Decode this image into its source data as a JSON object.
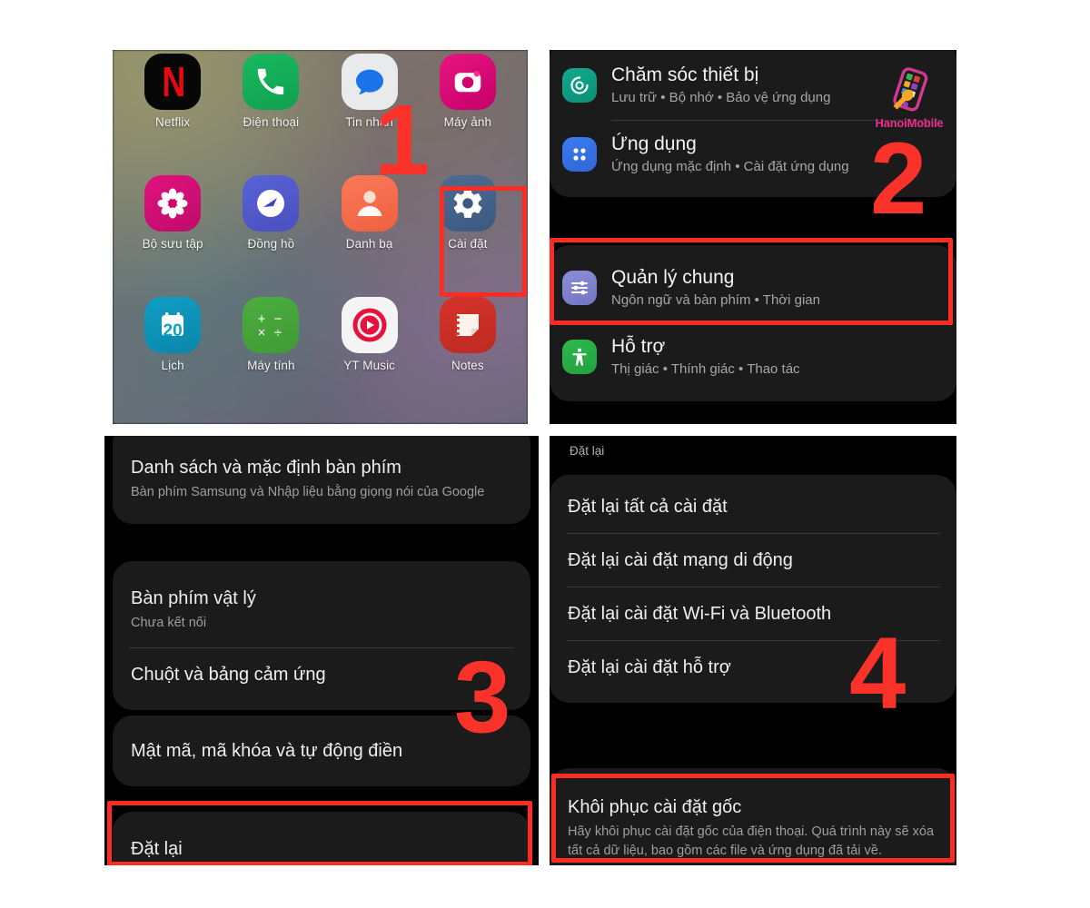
{
  "home": {
    "apps": [
      {
        "label": "Netflix",
        "icon": "netflix-icon"
      },
      {
        "label": "Điện thoại",
        "icon": "phone-icon"
      },
      {
        "label": "Tin nhắn",
        "icon": "messages-icon"
      },
      {
        "label": "Máy ảnh",
        "icon": "camera-icon"
      },
      {
        "label": "Bộ sưu tập",
        "icon": "gallery-icon"
      },
      {
        "label": "Đồng hồ",
        "icon": "clock-icon"
      },
      {
        "label": "Danh bạ",
        "icon": "contacts-icon"
      },
      {
        "label": "Cài đặt",
        "icon": "settings-gear-icon"
      },
      {
        "label": "Lịch",
        "icon": "calendar-icon"
      },
      {
        "label": "Máy tính",
        "icon": "calculator-icon"
      },
      {
        "label": "YT Music",
        "icon": "youtube-music-icon"
      },
      {
        "label": "Notes",
        "icon": "notes-icon"
      }
    ],
    "calendar_day": "20"
  },
  "settings_menu": {
    "items": [
      {
        "title": "Chăm sóc thiết bị",
        "subtitle": "Lưu trữ • Bộ nhớ • Bảo vệ ứng dụng",
        "icon": "device-care-icon"
      },
      {
        "title": "Ứng dụng",
        "subtitle": "Ứng dụng mặc định • Cài đặt ứng dụng",
        "icon": "apps-grid-icon"
      },
      {
        "title": "Quản lý chung",
        "subtitle": "Ngôn ngữ và bàn phím • Thời gian",
        "icon": "sliders-icon"
      },
      {
        "title": "Hỗ trợ",
        "subtitle": "Thị giác • Thính giác • Thao tác",
        "icon": "accessibility-icon"
      }
    ]
  },
  "general_management": {
    "items": [
      {
        "title": "Danh sách và mặc định bàn phím",
        "subtitle": "Bàn phím Samsung và Nhập liệu bằng giọng nói của Google"
      },
      {
        "title": "Bàn phím vật lý",
        "subtitle": "Chưa kết nối"
      },
      {
        "title": "Chuột và bảng cảm ứng",
        "subtitle": ""
      },
      {
        "title": "Mật mã, mã khóa và tự động điền",
        "subtitle": ""
      },
      {
        "title": "Đặt lại",
        "subtitle": ""
      }
    ]
  },
  "reset_screen": {
    "group_header": "Đặt lại",
    "items": [
      {
        "title": "Đặt lại tất cả cài đặt",
        "subtitle": ""
      },
      {
        "title": "Đặt lại cài đặt mạng di động",
        "subtitle": ""
      },
      {
        "title": "Đặt lại cài đặt Wi-Fi và Bluetooth",
        "subtitle": ""
      },
      {
        "title": "Đặt lại cài đặt hỗ trợ",
        "subtitle": ""
      },
      {
        "title": "Khôi phục cài đặt gốc",
        "subtitle": "Hãy khôi phục cài đặt gốc của điện thoại. Quá trình này sẽ xóa tất cả dữ liệu, bao gồm các file và ứng dụng đã tải về."
      }
    ]
  },
  "callouts": {
    "one": "1",
    "two": "2",
    "three": "3",
    "four": "4"
  },
  "watermark": {
    "text": "HanoiMobile"
  },
  "colors": {
    "callout_red": "#fb3229",
    "highlight_border": "#fb2d22",
    "watermark_pink": "#ef2c8a",
    "card_bg": "#1b1b1b",
    "panel_bg": "#000000"
  }
}
